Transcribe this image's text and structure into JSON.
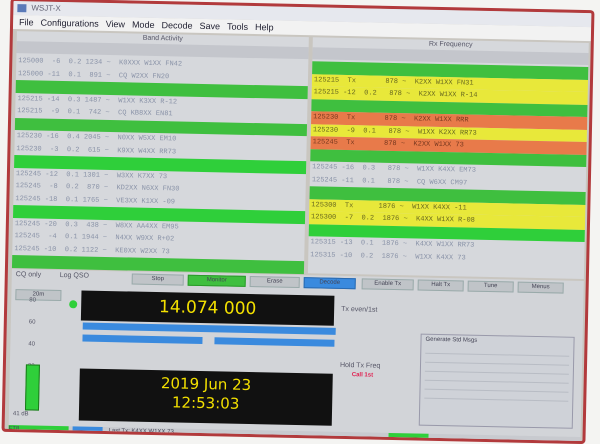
{
  "window": {
    "title": "WSJT-X"
  },
  "menu": [
    "File",
    "Configurations",
    "View",
    "Mode",
    "Decode",
    "Save",
    "Tools",
    "Help"
  ],
  "band_activity": {
    "title": "Band Activity",
    "rows": [
      {
        "text": "125000  -6  0.2 1234 ~  K0XXX W1XX FN42",
        "style": ""
      },
      {
        "text": "125000 -11  0.1  891 ~  CQ W2XX FN20",
        "style": ""
      },
      {
        "text": "",
        "style": "sep"
      },
      {
        "text": "125215 -14  0.3 1487 ~  W1XX K3XX R-12",
        "style": ""
      },
      {
        "text": "125215  -9  0.1  742 ~  CQ KB8XX EN81",
        "style": ""
      },
      {
        "text": "",
        "style": "sep"
      },
      {
        "text": "125230 -16  0.4 2045 ~  N0XX W5XX EM10",
        "style": ""
      },
      {
        "text": "125230  -3  0.2  615 ~  K9XX W4XX RR73",
        "style": ""
      },
      {
        "text": "",
        "style": "cq"
      },
      {
        "text": "125245 -12  0.1 1301 ~  W3XX K7XX 73",
        "style": ""
      },
      {
        "text": "125245  -8  0.2  870 ~  KD2XX N6XX FN30",
        "style": ""
      },
      {
        "text": "125245 -18  0.1 1765 ~  VE3XX K1XX -09",
        "style": ""
      },
      {
        "text": "",
        "style": "cq"
      },
      {
        "text": "125245 -20  0.3  438 ~  W8XX AA4XX EM95",
        "style": ""
      },
      {
        "text": "125245  -4  0.1 1944 ~  N4XX W9XX R+02",
        "style": ""
      },
      {
        "text": "125245 -10  0.2 1122 ~  KE0XX W2XX 73",
        "style": ""
      },
      {
        "text": "",
        "style": "sep"
      },
      {
        "text": "125300 -15  0.1 2210 ~  CQ DX K5XX EM12",
        "style": ""
      }
    ]
  },
  "rx_frequency": {
    "title": "Rx Frequency",
    "rows": [
      {
        "text": "",
        "style": "sep"
      },
      {
        "text": "125215  Tx       878 ~  K2XX W1XX FN31",
        "style": "yel"
      },
      {
        "text": "125215 -12  0.2   878 ~  K2XX W1XX R-14",
        "style": "yel"
      },
      {
        "text": "",
        "style": "sep"
      },
      {
        "text": "125230  Tx       878 ~  K2XX W1XX RRR",
        "style": "red"
      },
      {
        "text": "125230  -9  0.1   878 ~  W1XX K2XX RR73",
        "style": "yel"
      },
      {
        "text": "125245  Tx       878 ~  K2XX W1XX 73",
        "style": "red"
      },
      {
        "text": "",
        "style": "sep"
      },
      {
        "text": "125245 -16  0.3   878 ~  W1XX K4XX EM73",
        "style": ""
      },
      {
        "text": "125245 -11  0.1   878 ~  CQ W6XX CM97",
        "style": ""
      },
      {
        "text": "",
        "style": "sep"
      },
      {
        "text": "125300  Tx      1876 ~  W1XX K4XX -11",
        "style": "yel"
      },
      {
        "text": "125300  -7  0.2  1876 ~  K4XX W1XX R-08",
        "style": "yel"
      },
      {
        "text": "",
        "style": "cq"
      },
      {
        "text": "125315 -13  0.1  1876 ~  K4XX W1XX RR73",
        "style": ""
      },
      {
        "text": "125315 -10  0.2  1876 ~  W1XX K4XX 73",
        "style": ""
      }
    ]
  },
  "controls": {
    "cq_only": "CQ only",
    "log_qso": "Log QSO",
    "stop": "Stop",
    "monitor": "Monitor",
    "erase": "Erase",
    "decode": "Decode",
    "enable_tx": "Enable Tx",
    "halt_tx": "Halt Tx",
    "tune": "Tune",
    "menus": "Menus",
    "band": "20m",
    "frequency": "14.074 000",
    "tx_even": "Tx even/1st",
    "hold_tx_freq": "Hold Tx Freq",
    "red_label": "Call 1st",
    "date": "2019 Jun 23",
    "time": "12:53:03",
    "db_scale": [
      "80",
      "60",
      "40",
      "20",
      "0"
    ],
    "db_label": "41 dB",
    "tx_panel_title": "Generate Std Msgs",
    "status": {
      "mode": "FT8",
      "last_tx": "Last Tx: K4XX W1XX 73"
    }
  },
  "colors": {
    "cq_highlight": "#2fcf3a",
    "tx_highlight": "#e8e83a",
    "my_call": "#e87a4a",
    "frequency_display": "#f3e000",
    "monitor_accent": "#3a8ade"
  }
}
